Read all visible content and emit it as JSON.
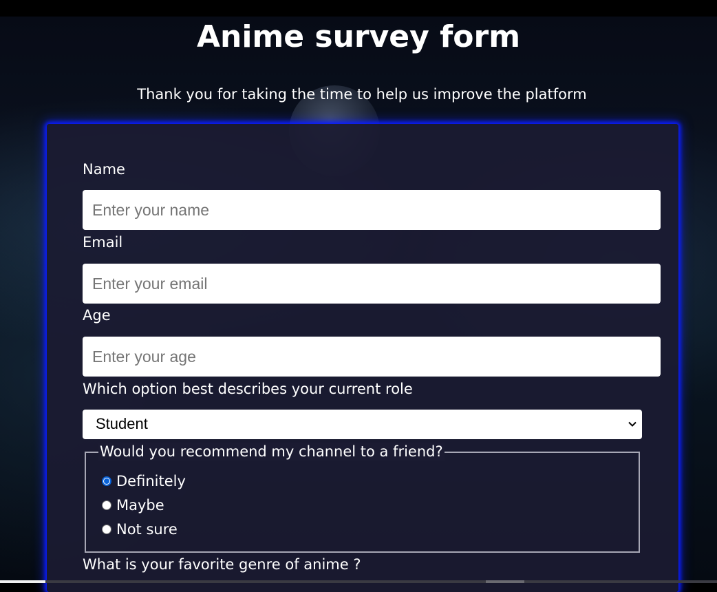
{
  "header": {
    "title": "Anime survey form",
    "description": "Thank you for taking the time to help us improve the platform"
  },
  "form": {
    "name_label": "Name",
    "name_placeholder": "Enter your name",
    "name_value": "",
    "email_label": "Email",
    "email_placeholder": "Enter your email",
    "email_value": "",
    "age_label": "Age",
    "age_placeholder": "Enter your age",
    "age_value": "",
    "role_label": "Which option best describes your current role",
    "role_selected": "Student",
    "recommend_legend": "Would you recommend my channel to a friend?",
    "recommend_options": [
      {
        "label": "Definitely",
        "checked": true
      },
      {
        "label": "Maybe",
        "checked": false
      },
      {
        "label": "Not sure",
        "checked": false
      }
    ],
    "genre_label": "What is your favorite genre of anime ?"
  },
  "colors": {
    "card_glow": "#0a1cff",
    "card_background": "#1b1b32",
    "radio_accent": "#0a63d8",
    "text": "#ffffff"
  },
  "icons": {
    "select_arrow": "chevron-down-icon"
  }
}
